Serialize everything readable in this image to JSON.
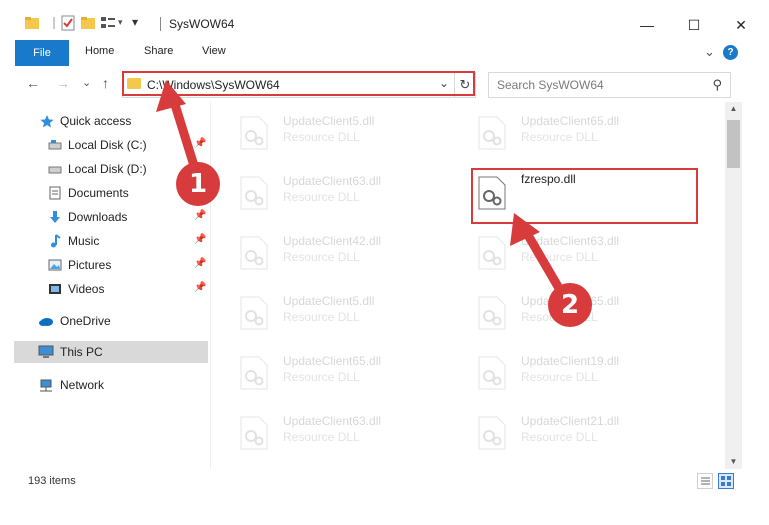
{
  "window": {
    "title": "SysWOW64",
    "controls": {
      "minimize": "—",
      "maximize": "☐",
      "close": "✕"
    }
  },
  "ribbon": {
    "tabs": [
      "File",
      "Home",
      "Share",
      "View"
    ],
    "expand_glyph": "⌄",
    "help_glyph": "?"
  },
  "nav": {
    "back": "←",
    "forward": "→",
    "recent": "⌄",
    "up": "↑",
    "address": "C:\\Windows\\SysWOW64",
    "address_dropdown": "⌄",
    "refresh": "↻",
    "search_placeholder": "Search SysWOW64",
    "search_glyph": "⚲"
  },
  "sidebar": {
    "items": [
      {
        "label": "Quick access",
        "icon": "star-icon",
        "pinned": false
      },
      {
        "label": "Local Disk (C:)",
        "icon": "drive-icon",
        "pinned": true
      },
      {
        "label": "Local Disk (D:)",
        "icon": "drive-icon",
        "pinned": false
      },
      {
        "label": "Documents",
        "icon": "documents-icon",
        "pinned": false
      },
      {
        "label": "Downloads",
        "icon": "download-icon",
        "pinned": true
      },
      {
        "label": "Music",
        "icon": "music-icon",
        "pinned": true
      },
      {
        "label": "Pictures",
        "icon": "pictures-icon",
        "pinned": true
      },
      {
        "label": "Videos",
        "icon": "videos-icon",
        "pinned": true
      },
      {
        "label": "OneDrive",
        "icon": "cloud-icon",
        "pinned": false
      },
      {
        "label": "This PC",
        "icon": "computer-icon",
        "pinned": false,
        "selected": true
      },
      {
        "label": "Network",
        "icon": "network-icon",
        "pinned": false
      }
    ],
    "pin_glyph": "📌"
  },
  "files": {
    "left": [
      {
        "name": "UpdateClient5.dll",
        "type": "Resource DLL"
      },
      {
        "name": "UpdateClient63.dll",
        "type": "Resource DLL"
      },
      {
        "name": "UpdateClient42.dll",
        "type": "Resource DLL"
      },
      {
        "name": "UpdateClient5.dll",
        "type": "Resource DLL"
      },
      {
        "name": "UpdateClient65.dll",
        "type": "Resource DLL"
      },
      {
        "name": "UpdateClient63.dll",
        "type": "Resource DLL"
      }
    ],
    "right": [
      {
        "name": "UpdateClient65.dll",
        "type": "Resource DLL"
      },
      {
        "name": "fzrespo.dll",
        "type": ""
      },
      {
        "name": "UpdateClient63.dll",
        "type": "Resource DLL"
      },
      {
        "name": "UpdateClient65.dll",
        "type": "Resource DLL"
      },
      {
        "name": "UpdateClient19.dll",
        "type": "Resource DLL"
      },
      {
        "name": "UpdateClient21.dll",
        "type": "Resource DLL"
      }
    ]
  },
  "status": {
    "item_count": "193 items"
  },
  "annotations": {
    "badge1": "1",
    "badge2": "2",
    "color": "#d83b3b"
  },
  "colors": {
    "accent": "#1979ca",
    "selection": "#d9d9d9",
    "highlight": "#d83b3b"
  }
}
